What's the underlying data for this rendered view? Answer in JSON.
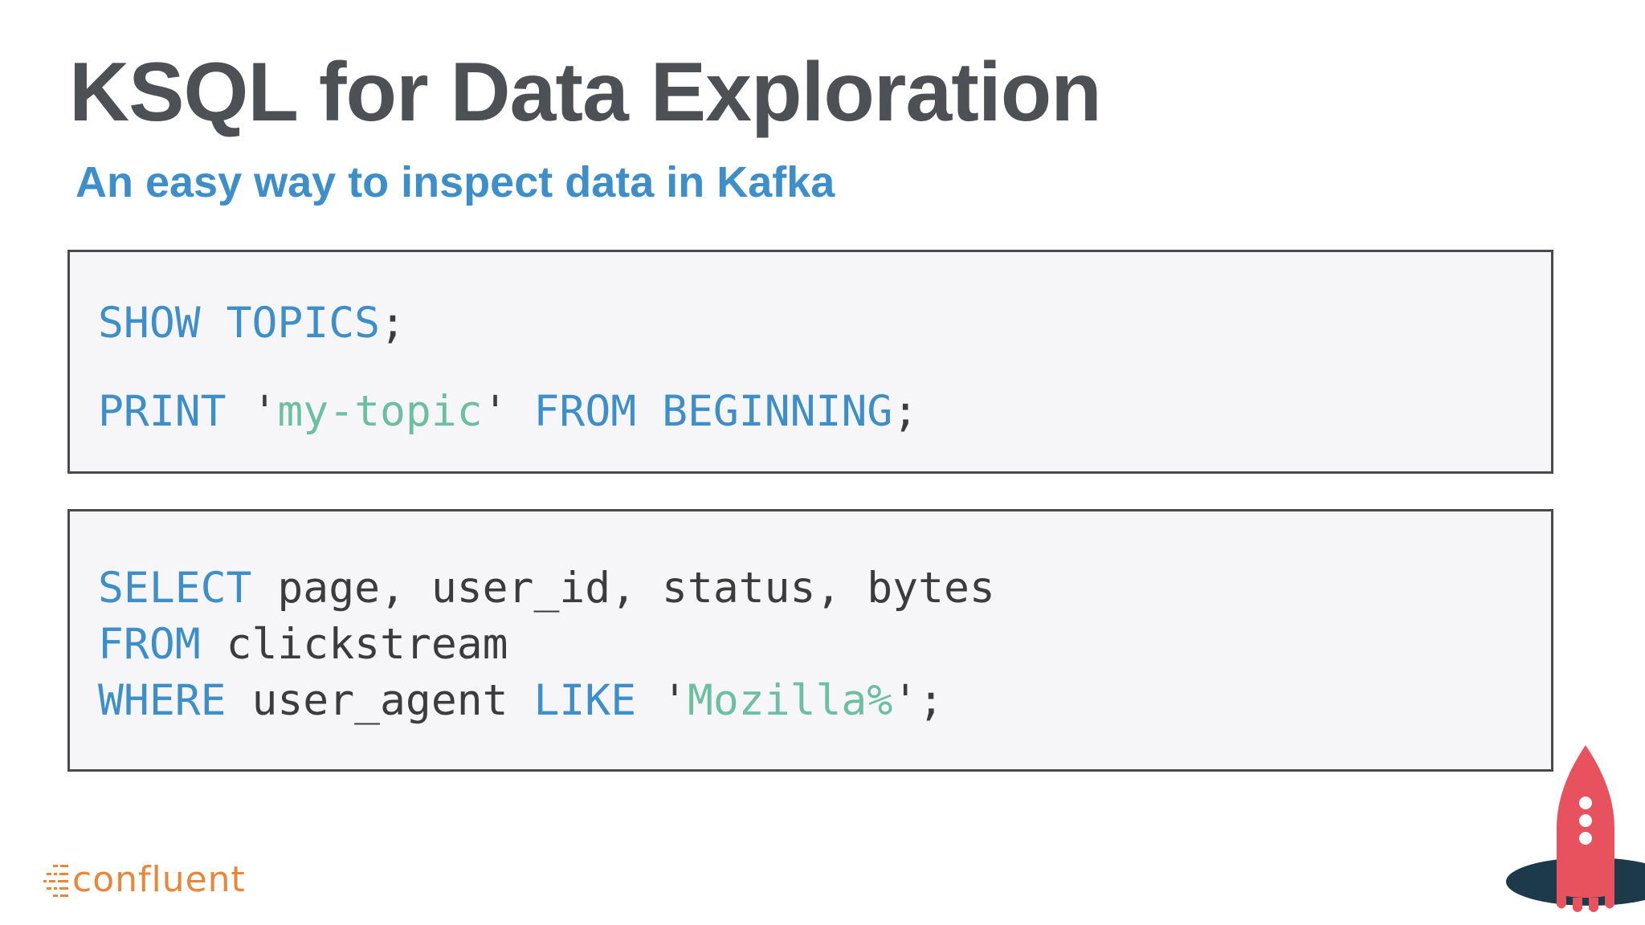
{
  "slide": {
    "title": "KSQL for Data Exploration",
    "subtitle": "An easy way to inspect data in Kafka"
  },
  "code_block_1": {
    "line1": {
      "show_kw": "SHOW",
      "topics_kw": "TOPICS",
      "end": ";"
    },
    "line2": {
      "print_kw": "PRINT",
      "quote_open": "'",
      "topic": "my-topic",
      "quote_close": "'",
      "from_kw": "FROM",
      "beginning_kw": "BEGINNING",
      "end": ";"
    }
  },
  "code_block_2": {
    "line1": {
      "select_kw": "SELECT",
      "columns": "page, user_id, status, bytes"
    },
    "line2": {
      "from_kw": "FROM",
      "stream": "clickstream"
    },
    "line3": {
      "where_kw": "WHERE",
      "column": "user_agent",
      "like_kw": "LIKE",
      "quote_open": "'",
      "pattern": "Mozilla%",
      "quote_close": "'",
      "end": ";"
    }
  },
  "logo": {
    "text": "confluent",
    "icon": "confluent-logo-icon",
    "color": "#e8863a"
  },
  "decoration": {
    "icon": "rocket-icon",
    "rocket_color": "#e8525f",
    "portal_color": "#1c3a4a"
  },
  "colors": {
    "title": "#4d5054",
    "subtitle": "#3d8ec9",
    "keyword": "#3d8ec9",
    "string": "#6cc0a1",
    "text": "#3c3c3c",
    "code_background": "#f6f6f8"
  }
}
